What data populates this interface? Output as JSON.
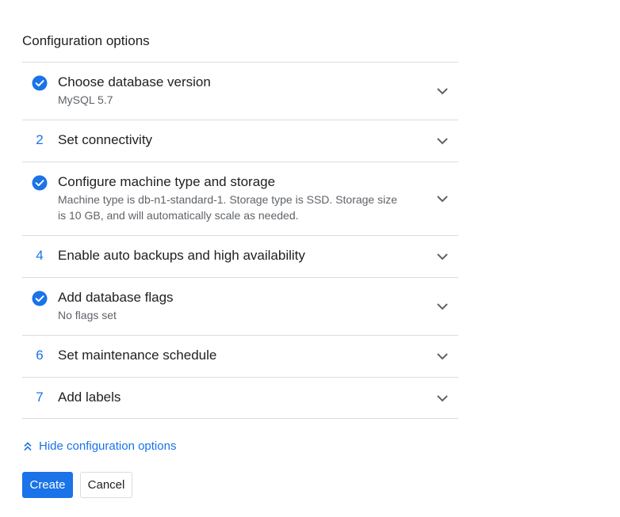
{
  "section": {
    "title": "Configuration options"
  },
  "rows": [
    {
      "status": "done",
      "label": "Choose database version",
      "summary": "MySQL 5.7"
    },
    {
      "status": "pending",
      "number": "2",
      "label": "Set connectivity"
    },
    {
      "status": "done",
      "label": "Configure machine type and storage",
      "summary": "Machine type is db-n1-standard-1. Storage type is SSD. Storage size is 10 GB, and will automatically scale as needed."
    },
    {
      "status": "pending",
      "number": "4",
      "label": "Enable auto backups and high availability"
    },
    {
      "status": "done",
      "label": "Add database flags",
      "summary": "No flags set"
    },
    {
      "status": "pending",
      "number": "6",
      "label": "Set maintenance schedule"
    },
    {
      "status": "pending",
      "number": "7",
      "label": "Add labels"
    }
  ],
  "hide_link": {
    "label": "Hide configuration options",
    "icon": "chevron-double-up-icon"
  },
  "buttons": {
    "create": "Create",
    "cancel": "Cancel"
  },
  "colors": {
    "accent": "#1a73e8",
    "divider": "#dadce0",
    "secondary_text": "#5f6368"
  }
}
